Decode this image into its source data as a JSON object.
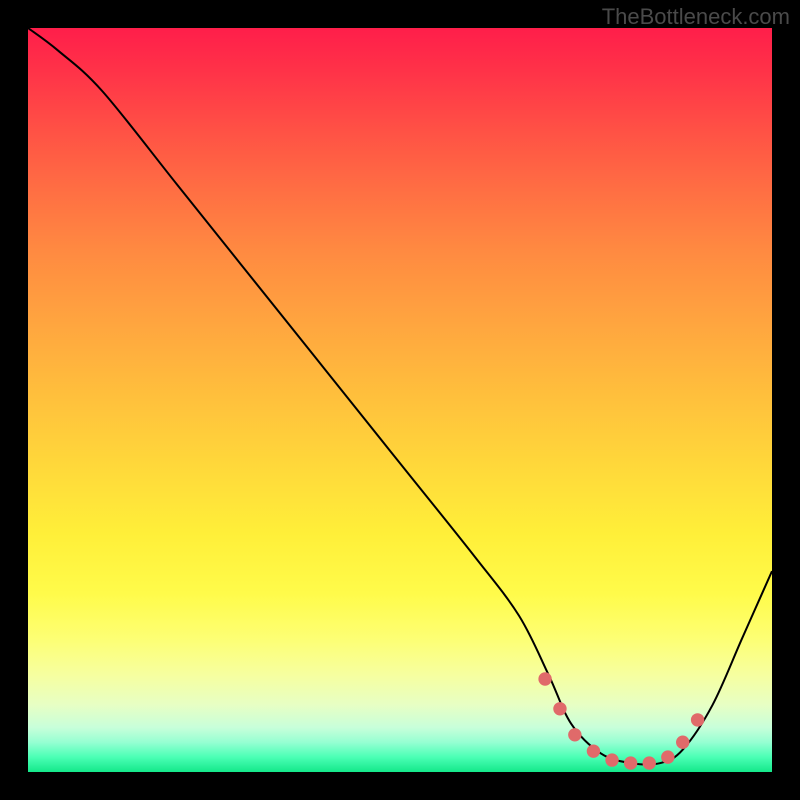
{
  "watermark": "TheBottleneck.com",
  "chart_data": {
    "type": "line",
    "title": "",
    "xlabel": "",
    "ylabel": "",
    "xlim": [
      0,
      100
    ],
    "ylim": [
      0,
      100
    ],
    "series": [
      {
        "name": "bottleneck-curve",
        "color": "#000000",
        "x": [
          0,
          4,
          10,
          20,
          30,
          40,
          50,
          60,
          66,
          70,
          73,
          77,
          81,
          85,
          88,
          92,
          96,
          100
        ],
        "y": [
          100,
          97,
          91.5,
          79,
          66.5,
          54,
          41.5,
          29,
          21,
          13,
          6.5,
          2.5,
          1.2,
          1.2,
          3,
          9,
          18,
          27
        ]
      },
      {
        "name": "sweet-spot-markers",
        "type": "scatter",
        "color": "#e06a6a",
        "x": [
          69.5,
          71.5,
          73.5,
          76,
          78.5,
          81,
          83.5,
          86,
          88,
          90
        ],
        "y": [
          12.5,
          8.5,
          5,
          2.8,
          1.6,
          1.2,
          1.2,
          2,
          4,
          7
        ]
      }
    ],
    "background_gradient": {
      "stops": [
        {
          "pos": 0,
          "color": "#ff1e4a"
        },
        {
          "pos": 50,
          "color": "#ffc13c"
        },
        {
          "pos": 82,
          "color": "#fdff73"
        },
        {
          "pos": 100,
          "color": "#14e88a"
        }
      ]
    }
  }
}
